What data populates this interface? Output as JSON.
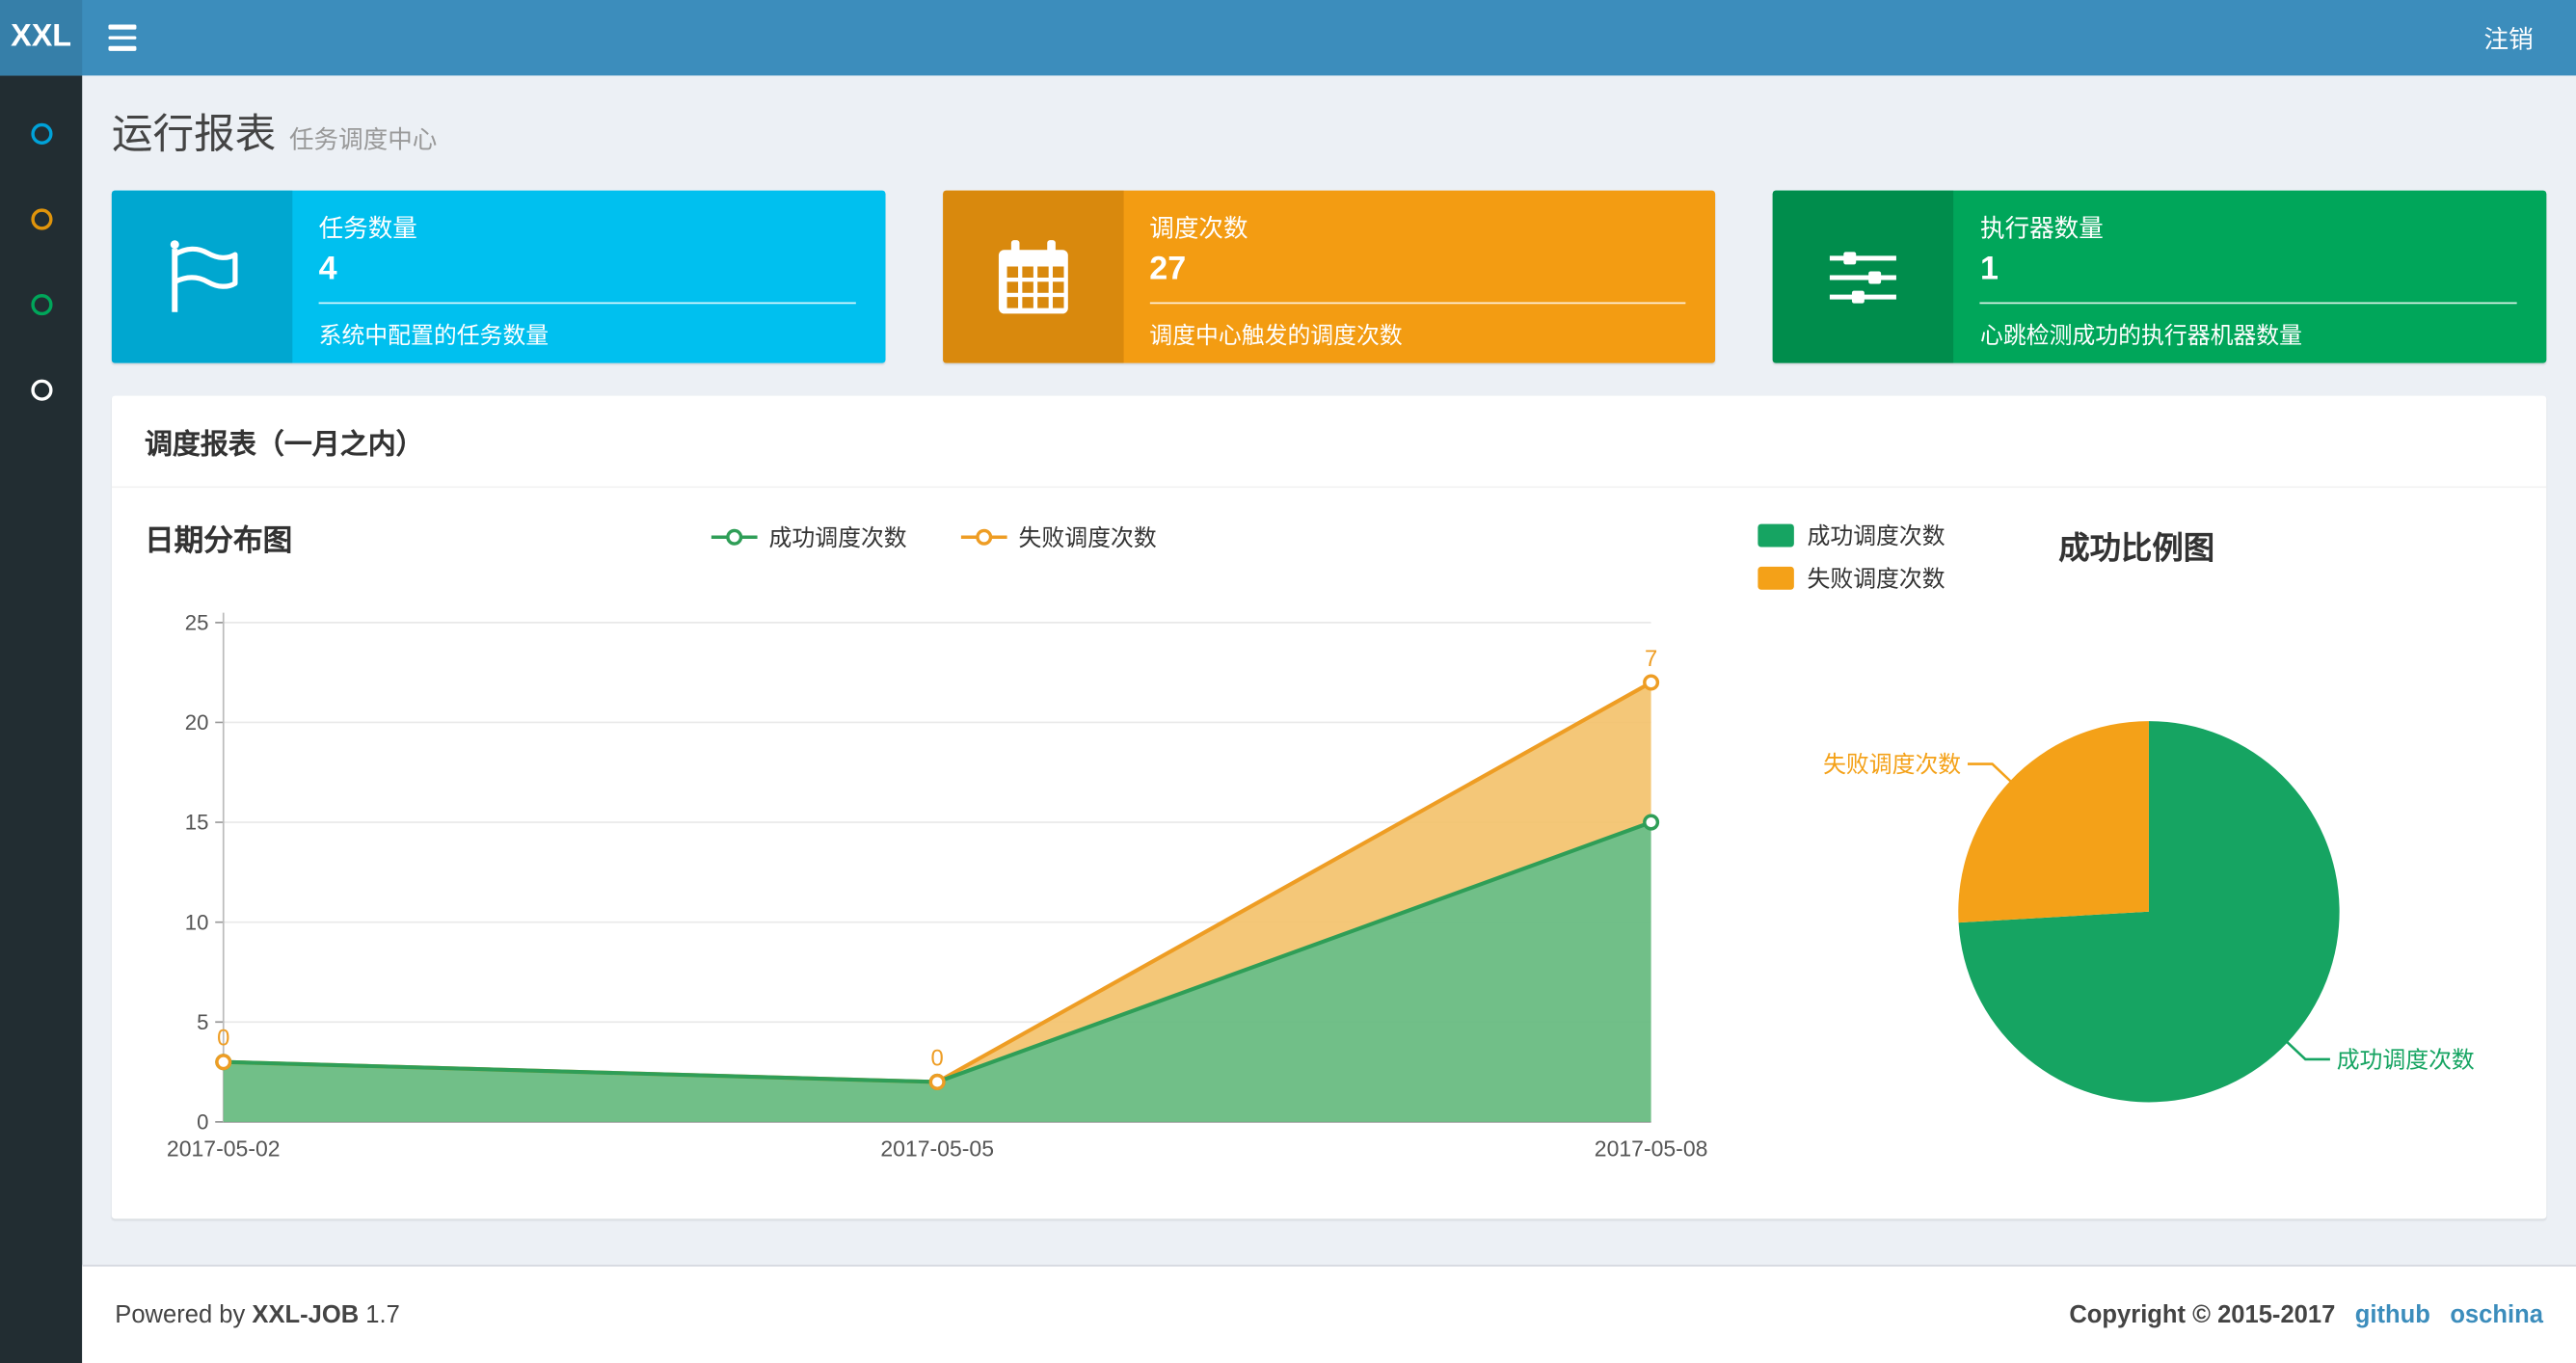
{
  "navbar": {
    "logo": "XXL",
    "logout_label": "注销"
  },
  "sidebar": {
    "items": [
      {
        "name": "menu-1",
        "color": "#00a2d9"
      },
      {
        "name": "menu-2",
        "color": "#e0940b"
      },
      {
        "name": "menu-3",
        "color": "#00a65a"
      },
      {
        "name": "menu-4",
        "color": "#ffffff"
      }
    ]
  },
  "page_header": {
    "title": "运行报表",
    "subtitle": "任务调度中心"
  },
  "info_boxes": [
    {
      "icon": "flag-icon",
      "label": "任务数量",
      "value": "4",
      "description": "系统中配置的任务数量",
      "color": "#00c0ef",
      "icon_bg": "#00a7d0"
    },
    {
      "icon": "calendar-icon",
      "label": "调度次数",
      "value": "27",
      "description": "调度中心触发的调度次数",
      "color": "#f39c12",
      "icon_bg": "#d9890d"
    },
    {
      "icon": "sliders-icon",
      "label": "执行器数量",
      "value": "1",
      "description": "心跳检测成功的执行器机器数量",
      "color": "#00a65a",
      "icon_bg": "#008d4c"
    }
  ],
  "report_panel": {
    "title": "调度报表（一月之内）"
  },
  "chart_data": [
    {
      "type": "area",
      "title": "日期分布图",
      "x": [
        "2017-05-02",
        "2017-05-05",
        "2017-05-08"
      ],
      "ylim": [
        0,
        25
      ],
      "yticks": [
        0,
        5,
        10,
        15,
        20,
        25
      ],
      "stacked": true,
      "grid": true,
      "legend_position": "top-center",
      "series": [
        {
          "name": "成功调度次数",
          "values": [
            3,
            2,
            15
          ],
          "line_color": "#2f9e57",
          "fill_color": "#69bc82"
        },
        {
          "name": "失败调度次数",
          "values": [
            0,
            0,
            7
          ],
          "point_labels": [
            "0",
            "0",
            "7"
          ],
          "line_color": "#ee9d24",
          "fill_color": "#f3c169"
        }
      ]
    },
    {
      "type": "pie",
      "title": "成功比例图",
      "legend_position": "top-left",
      "slices": [
        {
          "name": "成功调度次数",
          "value": 20,
          "color": "#16a462"
        },
        {
          "name": "失败调度次数",
          "value": 7,
          "color": "#f4a118"
        }
      ]
    }
  ],
  "footer": {
    "powered_by": "Powered by",
    "product": "XXL-JOB",
    "version": "1.7",
    "copyright": "Copyright © 2015-2017",
    "links": [
      {
        "label": "github"
      },
      {
        "label": "oschina"
      }
    ]
  }
}
